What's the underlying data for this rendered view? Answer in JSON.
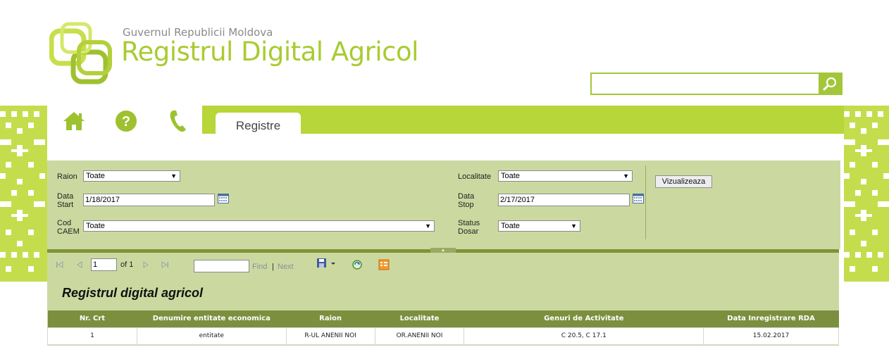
{
  "header": {
    "gov_name": "Guvernul Republicii Moldova",
    "app_title": "Registrul Digital Agricol"
  },
  "search": {
    "value": "",
    "placeholder": ""
  },
  "nav": {
    "icons": [
      "home-icon",
      "help-icon",
      "phone-icon"
    ],
    "tab_label": "Registre"
  },
  "filters": {
    "raion_label": "Raion",
    "raion_value": "Toate",
    "data_start_label": "Data Start",
    "data_start_value": "1/18/2017",
    "cod_caem_label": "Cod CAEM",
    "cod_caem_value": "Toate",
    "localitate_label": "Localitate",
    "localitate_value": "Toate",
    "data_stop_label": "Data Stop",
    "data_stop_value": "2/17/2017",
    "status_dosar_label": "Status Dosar",
    "status_dosar_value": "Toate",
    "view_button": "Vizualizeaza"
  },
  "toolbar": {
    "page_value": "1",
    "page_of": "of 1",
    "find_label": "Find",
    "separator": "|",
    "next_label": "Next"
  },
  "report": {
    "title": "Registrul digital agricol",
    "columns": [
      "Nr. Crt",
      "Denumire entitate economica",
      "Raion",
      "Localitate",
      "Genuri de Activitate",
      "Data Inregistrare RDA"
    ],
    "rows": [
      [
        "1",
        "entitate",
        "R-UL ANENII NOI",
        "OR.ANENII NOI",
        "C 20.5, C 17.1",
        "15.02.2017"
      ]
    ]
  },
  "colors": {
    "brand_green": "#a9cb32",
    "nav_green": "#b7d639",
    "panel_green": "#cbd9a0",
    "header_row": "#7c8f3e"
  }
}
